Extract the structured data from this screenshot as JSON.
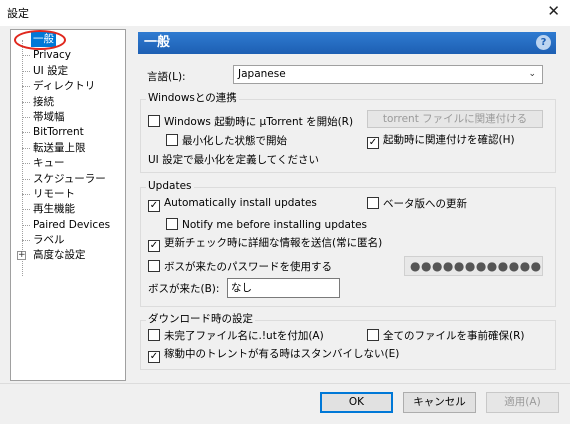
{
  "window": {
    "title": "設定",
    "close_glyph": "✕"
  },
  "tree": {
    "items": [
      {
        "label": "一般"
      },
      {
        "label": "Privacy"
      },
      {
        "label": "UI 設定"
      },
      {
        "label": "ディレクトリ"
      },
      {
        "label": "接続"
      },
      {
        "label": "帯域幅"
      },
      {
        "label": "BitTorrent"
      },
      {
        "label": "転送量上限"
      },
      {
        "label": "キュー"
      },
      {
        "label": "スケジューラー"
      },
      {
        "label": "リモート"
      },
      {
        "label": "再生機能"
      },
      {
        "label": "Paired Devices"
      },
      {
        "label": "ラベル"
      },
      {
        "label": "高度な設定"
      }
    ],
    "expand_glyph": "+"
  },
  "header": {
    "title": "一般",
    "help_glyph": "?"
  },
  "language": {
    "label": "言語(L):",
    "value": "Japanese",
    "arrow": "⌄"
  },
  "windows_integration": {
    "title": "Windowsとの連携",
    "start_on_boot": "Windows 起動時に µTorrent を開始(R)",
    "start_minimized": "最小化した状態で開始",
    "associate_button": "torrent ファイルに関連付ける",
    "check_association": "起動時に関連付けを確認(H)",
    "minimize_text": "UI 設定で最小化を定義してください"
  },
  "updates": {
    "title": "Updates",
    "auto_install": "Automatically install updates",
    "beta": "ベータ版への更新",
    "notify": "Notify me before installing updates",
    "send_info": "更新チェック時に詳細な情報を送信(常に匿名)",
    "boss_password": "ボスが来たのパスワードを使用する",
    "boss_key_label": "ボスが来た(B):",
    "boss_key_value": "なし",
    "password_mask": "●●●●●●●●●●●●"
  },
  "download": {
    "title": "ダウンロード時の設定",
    "append_lut": "未完了ファイル名に.!utを付加(A)",
    "preallocate": "全てのファイルを事前確保(R)",
    "prevent_standby": "稼動中のトレントが有る時はスタンバイしない(E)"
  },
  "buttons": {
    "ok": "OK",
    "cancel": "キャンセル",
    "apply": "適用(A)"
  },
  "check_glyph": "✓"
}
